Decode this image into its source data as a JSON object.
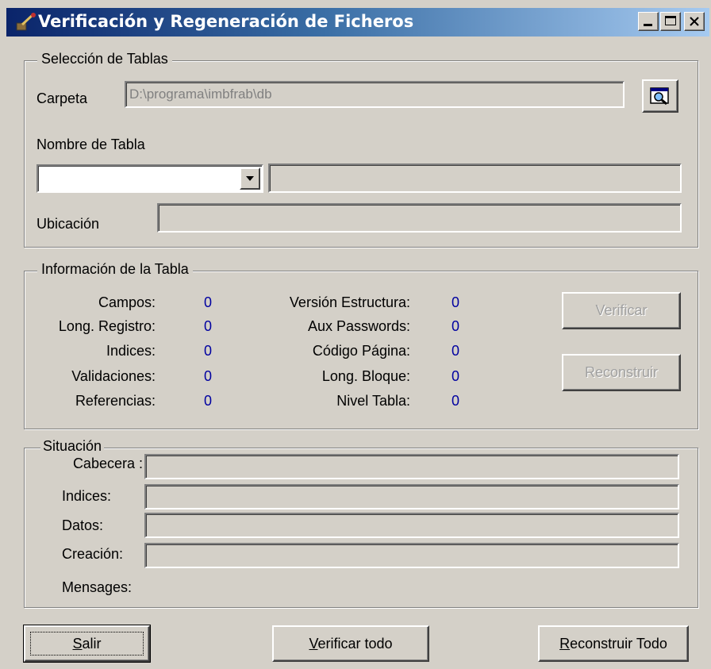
{
  "window": {
    "title": "Verificación y Regeneración de Ficheros"
  },
  "title_buttons": [
    {
      "name": "minimize-button",
      "glyph": "_"
    },
    {
      "name": "maximize-button",
      "glyph": "☐"
    },
    {
      "name": "close-button",
      "glyph": "✕"
    }
  ],
  "seleccion": {
    "legend": "Selección de Tablas",
    "carpeta_label": "Carpeta",
    "carpeta_value": "D:\\programa\\imbfrab\\db",
    "nombre_label": "Nombre de Tabla",
    "nombre_value": "",
    "nombre_desc": "",
    "ubicacion_label": "Ubicación",
    "ubicacion_value": ""
  },
  "info": {
    "legend": "Información de la Tabla",
    "left": [
      {
        "label": "Campos:",
        "value": "0"
      },
      {
        "label": "Long. Registro:",
        "value": "0"
      },
      {
        "label": "Indices:",
        "value": "0"
      },
      {
        "label": "Validaciones:",
        "value": "0"
      },
      {
        "label": "Referencias:",
        "value": "0"
      }
    ],
    "right": [
      {
        "label": "Versión Estructura:",
        "value": "0"
      },
      {
        "label": "Aux Passwords:",
        "value": "0"
      },
      {
        "label": "Código Página:",
        "value": "0"
      },
      {
        "label": "Long. Bloque:",
        "value": "0"
      },
      {
        "label": "Nivel Tabla:",
        "value": "0"
      }
    ],
    "verificar_label": "Verificar",
    "reconstruir_label": "Reconstruir"
  },
  "situacion": {
    "legend": "Situación",
    "cabecera_label": "Cabecera :",
    "indices_label": "Indices:",
    "datos_label": "Datos:",
    "creacion_label": "Creación:",
    "mensajes_label": "Mensages:"
  },
  "footer": {
    "salir_hot": "S",
    "salir_rest": "alir",
    "verificar_todo_hot": "V",
    "verificar_todo_rest": "erificar todo",
    "reconstruir_todo_hot": "R",
    "reconstruir_todo_rest": "econstruir Todo"
  },
  "colors": {
    "face": "#d4d0c8",
    "value_blue": "#0000a0",
    "title_start": "#0a246a",
    "title_end": "#a6caf0"
  }
}
